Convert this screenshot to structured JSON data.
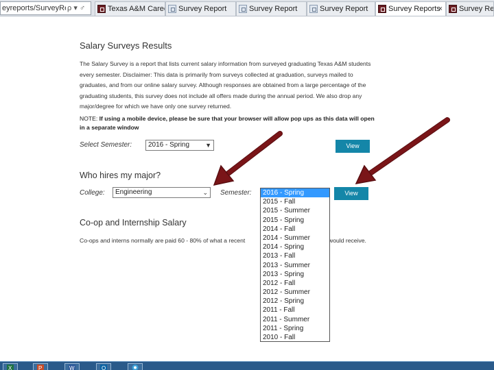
{
  "browser": {
    "address": "eyreports/SurveyReport",
    "address_icons": "ρ ▾ ♂",
    "tabs": [
      {
        "label": "Texas A&M Career...",
        "favicon": "aggie-favicon",
        "active": false
      },
      {
        "label": "Survey Report",
        "favicon": "page-favicon",
        "active": false
      },
      {
        "label": "Survey Report",
        "favicon": "page-favicon",
        "active": false
      },
      {
        "label": "Survey Report",
        "favicon": "page-favicon",
        "active": false
      },
      {
        "label": "Survey Reports",
        "favicon": "aggie-favicon",
        "active": true
      },
      {
        "label": "Survey Reports",
        "favicon": "aggie-favicon",
        "active": false
      }
    ],
    "tab_close": "×"
  },
  "page": {
    "title": "Salary Surveys Results",
    "intro": "The Salary Survey is a report that lists current salary information from surveyed graduating Texas A&M students every semester. Disclaimer: This data is primarily from surveys collected at graduation, surveys mailed to graduates, and from our online salary survey. Although responses are obtained from a large percentage of the graduating students, this survey does not include all offers made during the annual period. We also drop any major/degree for which we have only one survey returned.",
    "note_lead": "NOTE:",
    "note": " If using a mobile device, please be sure that your browser will allow pop ups as this data will open in a separate window",
    "select_semester_label": "Select Semester:",
    "select_semester_value": "2016 - Spring",
    "view_label": "View",
    "who_hires_heading": "Who hires my major?",
    "college_label": "College:",
    "college_value": "Engineering",
    "semester_label": "Semester:",
    "semester_options": [
      "2016 - Spring",
      "2015 - Fall",
      "2015 - Summer",
      "2015 - Spring",
      "2014 - Fall",
      "2014 - Summer",
      "2014 - Spring",
      "2013 - Fall",
      "2013 - Summer",
      "2013 - Spring",
      "2012 - Fall",
      "2012 - Summer",
      "2012 - Spring",
      "2011 - Fall",
      "2011 - Summer",
      "2011 - Spring",
      "2010 - Fall"
    ],
    "coop_heading": "Co-op and Internship Salary",
    "coop_text": "Co-ops and interns normally are paid 60 - 80% of what a recent",
    "coop_text_tail": "would receive."
  },
  "colors": {
    "button": "#1486a8",
    "selected_option": "#3399ff",
    "arrow": "#7a1518"
  },
  "taskbar": {
    "icons": [
      "excel-icon",
      "powerpoint-icon",
      "word-icon",
      "outlook-icon",
      "chrome-icon"
    ]
  }
}
